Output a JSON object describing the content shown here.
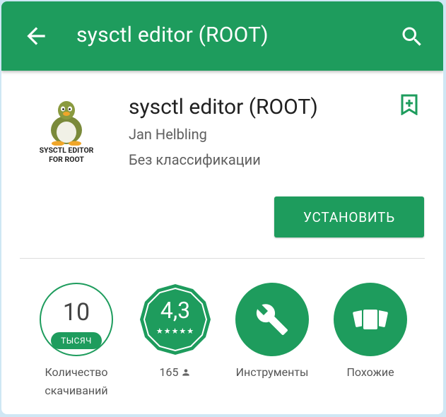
{
  "colors": {
    "accent": "#1e9c5d",
    "text_primary": "#212121",
    "text_secondary": "#5f5f5f"
  },
  "appbar": {
    "title": "sysctl editor (ROOT)",
    "back_icon": "arrow-left-icon",
    "search_icon": "search-icon"
  },
  "app": {
    "icon_text_line1": "SYSCTL EDITOR",
    "icon_text_line2": "FOR ROOT",
    "title": "sysctl editor (ROOT)",
    "developer": "Jan Helbling",
    "category": "Без классификации",
    "wishlist_icon": "bookmark-plus-icon",
    "install_label": "УСТАНОВИТЬ"
  },
  "stats": {
    "downloads": {
      "value": "10",
      "unit": "ТЫСЯЧ",
      "label_line1": "Количество",
      "label_line2": "скачиваний"
    },
    "rating": {
      "value": "4,3",
      "stars": "★★★★★",
      "count": "165"
    },
    "category": {
      "label": "Инструменты",
      "icon": "wrench-icon"
    },
    "similar": {
      "label": "Похожие",
      "icon": "cards-icon"
    }
  }
}
